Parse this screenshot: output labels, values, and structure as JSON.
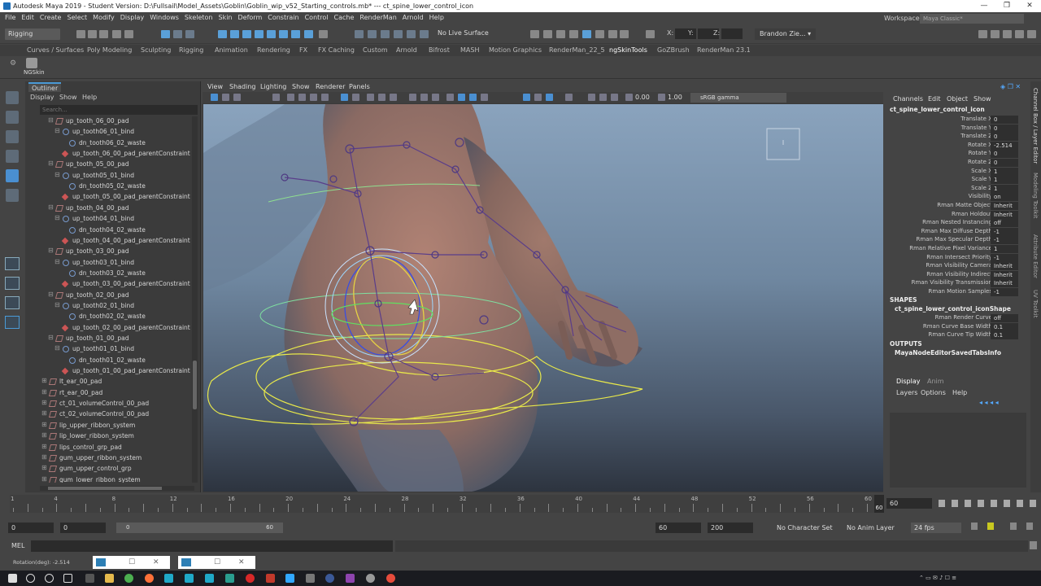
{
  "window": {
    "title": "Autodesk Maya 2019 - Student Version: D:\\Fullsail\\Model_Assets\\Goblin\\Goblin_wip_v52_Starting_controls.mb*  ---  ct_spine_lower_control_icon",
    "buttons": [
      "—",
      "❐",
      "✕"
    ]
  },
  "menubar": [
    "File",
    "Edit",
    "Create",
    "Select",
    "Modify",
    "Display",
    "Windows",
    "Skeleton",
    "Skin",
    "Deform",
    "Constrain",
    "Control",
    "Cache",
    "RenderMan",
    "Arnold",
    "Help"
  ],
  "statusline": {
    "menuset": "Rigging",
    "live_surface": "No Live Surface",
    "x_label": "X:",
    "y_label": "Y:",
    "z_label": "Z:",
    "user": "Brandon Zie...",
    "workspace_label": "Workspace :",
    "workspace_value": "Maya Classic*"
  },
  "shelf_tabs": [
    "Curves / Surfaces",
    "Poly Modeling",
    "Sculpting",
    "Rigging",
    "Animation",
    "Rendering",
    "FX",
    "FX Caching",
    "Custom",
    "Arnold",
    "Bifrost",
    "MASH",
    "Motion Graphics",
    "RenderMan_22_5",
    "ngSkinTools",
    "GoZBrush",
    "RenderMan 23.1"
  ],
  "shelf_active": "ngSkinTools",
  "shelf": {
    "ngskin_label": "NGSkin"
  },
  "outliner": {
    "tab": "Outliner",
    "menu": [
      "Display",
      "Show",
      "Help"
    ],
    "search_placeholder": "Search...",
    "rows": [
      {
        "indent": 1,
        "type": "grp",
        "exp": "⊟",
        "label": "up_tooth_06_00_pad"
      },
      {
        "indent": 2,
        "type": "jnt",
        "exp": "⊟",
        "label": "up_tooth06_01_bind"
      },
      {
        "indent": 3,
        "type": "jnt",
        "exp": "",
        "label": "dn_tooth06_02_waste"
      },
      {
        "indent": 2,
        "type": "con",
        "exp": "",
        "label": "up_tooth_06_00_pad_parentConstraint"
      },
      {
        "indent": 1,
        "type": "grp",
        "exp": "⊟",
        "label": "up_tooth_05_00_pad"
      },
      {
        "indent": 2,
        "type": "jnt",
        "exp": "⊟",
        "label": "up_tooth05_01_bind"
      },
      {
        "indent": 3,
        "type": "jnt",
        "exp": "",
        "label": "dn_tooth05_02_waste"
      },
      {
        "indent": 2,
        "type": "con",
        "exp": "",
        "label": "up_tooth_05_00_pad_parentConstraint"
      },
      {
        "indent": 1,
        "type": "grp",
        "exp": "⊟",
        "label": "up_tooth_04_00_pad"
      },
      {
        "indent": 2,
        "type": "jnt",
        "exp": "⊟",
        "label": "up_tooth04_01_bind"
      },
      {
        "indent": 3,
        "type": "jnt",
        "exp": "",
        "label": "dn_tooth04_02_waste"
      },
      {
        "indent": 2,
        "type": "con",
        "exp": "",
        "label": "up_tooth_04_00_pad_parentConstraint"
      },
      {
        "indent": 1,
        "type": "grp",
        "exp": "⊟",
        "label": "up_tooth_03_00_pad"
      },
      {
        "indent": 2,
        "type": "jnt",
        "exp": "⊟",
        "label": "up_tooth03_01_bind"
      },
      {
        "indent": 3,
        "type": "jnt",
        "exp": "",
        "label": "dn_tooth03_02_waste"
      },
      {
        "indent": 2,
        "type": "con",
        "exp": "",
        "label": "up_tooth_03_00_pad_parentConstraint"
      },
      {
        "indent": 1,
        "type": "grp",
        "exp": "⊟",
        "label": "up_tooth_02_00_pad"
      },
      {
        "indent": 2,
        "type": "jnt",
        "exp": "⊟",
        "label": "up_tooth02_01_bind"
      },
      {
        "indent": 3,
        "type": "jnt",
        "exp": "",
        "label": "dn_tooth02_02_waste"
      },
      {
        "indent": 2,
        "type": "con",
        "exp": "",
        "label": "up_tooth_02_00_pad_parentConstraint"
      },
      {
        "indent": 1,
        "type": "grp",
        "exp": "⊟",
        "label": "up_tooth_01_00_pad"
      },
      {
        "indent": 2,
        "type": "jnt",
        "exp": "⊟",
        "label": "up_tooth01_01_bind"
      },
      {
        "indent": 3,
        "type": "jnt",
        "exp": "",
        "label": "dn_tooth01_02_waste"
      },
      {
        "indent": 2,
        "type": "con",
        "exp": "",
        "label": "up_tooth_01_00_pad_parentConstraint"
      },
      {
        "indent": 0,
        "type": "grp",
        "exp": "⊞",
        "label": "lt_ear_00_pad"
      },
      {
        "indent": 0,
        "type": "grp",
        "exp": "⊞",
        "label": "rt_ear_00_pad"
      },
      {
        "indent": 0,
        "type": "grp",
        "exp": "⊞",
        "label": "ct_01_volumeControl_00_pad"
      },
      {
        "indent": 0,
        "type": "grp",
        "exp": "⊞",
        "label": "ct_02_volumeControl_00_pad"
      },
      {
        "indent": 0,
        "type": "grp",
        "exp": "⊞",
        "label": "lip_upper_ribbon_system"
      },
      {
        "indent": 0,
        "type": "grp",
        "exp": "⊞",
        "label": "lip_lower_ribbon_system"
      },
      {
        "indent": 0,
        "type": "grp",
        "exp": "⊞",
        "label": "lips_control_grp_pad"
      },
      {
        "indent": 0,
        "type": "grp",
        "exp": "⊞",
        "label": "gum_upper_ribbon_system"
      },
      {
        "indent": 0,
        "type": "grp",
        "exp": "⊞",
        "label": "gum_upper_control_grp"
      },
      {
        "indent": 0,
        "type": "grp",
        "exp": "⊞",
        "label": "gum_lower_ribbon_system"
      }
    ]
  },
  "viewport": {
    "menu": [
      "View",
      "Shading",
      "Lighting",
      "Show",
      "Renderer",
      "Panels"
    ],
    "exposure": "0.00",
    "gamma": "1.00",
    "colorspace": "sRGB gamma"
  },
  "channelbox": {
    "menu": [
      "Channels",
      "Edit",
      "Object",
      "Show"
    ],
    "node": "ct_spine_lower_control_icon",
    "attrs": [
      {
        "name": "Translate X",
        "value": "0"
      },
      {
        "name": "Translate Y",
        "value": "0"
      },
      {
        "name": "Translate Z",
        "value": "0"
      },
      {
        "name": "Rotate X",
        "value": "-2.514"
      },
      {
        "name": "Rotate Y",
        "value": "0"
      },
      {
        "name": "Rotate Z",
        "value": "0"
      },
      {
        "name": "Scale X",
        "value": "1"
      },
      {
        "name": "Scale Y",
        "value": "1"
      },
      {
        "name": "Scale Z",
        "value": "1"
      },
      {
        "name": "Visibility",
        "value": "on"
      },
      {
        "name": "Rman Matte Object",
        "value": "Inherit"
      },
      {
        "name": "Rman Holdout",
        "value": "Inherit"
      },
      {
        "name": "Rman Nested Instancing",
        "value": "off"
      },
      {
        "name": "Rman Max Diffuse Depth",
        "value": "-1"
      },
      {
        "name": "Rman Max Specular Depth",
        "value": "-1"
      },
      {
        "name": "Rman Relative Pixel Variance",
        "value": "1"
      },
      {
        "name": "Rman Intersect Priority",
        "value": "-1"
      },
      {
        "name": "Rman Visibility Camera",
        "value": "Inherit"
      },
      {
        "name": "Rman Visibility Indirect",
        "value": "Inherit"
      },
      {
        "name": "Rman Visibility Transmission",
        "value": "Inherit"
      },
      {
        "name": "Rman Motion Samples",
        "value": "-1"
      }
    ],
    "shapes_label": "SHAPES",
    "shape_node": "ct_spine_lower_control_iconShape",
    "shape_attrs": [
      {
        "name": "Rman Render Curve",
        "value": "off"
      },
      {
        "name": "Rman Curve Base Width",
        "value": "0.1"
      },
      {
        "name": "Rman Curve Tip Width",
        "value": "0.1"
      }
    ],
    "outputs_label": "OUTPUTS",
    "output_node": "MayaNodeEditorSavedTabsInfo",
    "layers_tabs": [
      "Display",
      "Anim"
    ],
    "layers_menu": [
      "Layers",
      "Options",
      "Help"
    ]
  },
  "sidetabs": [
    "Channel Box / Layer Editor",
    "Modeling Toolkit",
    "Attribute Editor",
    "UV Toolkit"
  ],
  "timeslider": {
    "ticks": [
      "1",
      "4",
      "8",
      "12",
      "16",
      "20",
      "24",
      "28",
      "32",
      "36",
      "40",
      "44",
      "48",
      "52",
      "56",
      "60"
    ],
    "current_frame": "60",
    "frame_field": "60"
  },
  "rangeslider": {
    "start": "0",
    "playback_start": "0",
    "range_start": "0",
    "range_end": "60",
    "playback_end": "60",
    "end": "200",
    "character_set": "No Character Set",
    "anim_layer": "No Anim Layer",
    "fps": "24 fps"
  },
  "cmdline": {
    "label": "MEL"
  },
  "helpline": {
    "text": "Rotation(deg):    -2.514"
  }
}
